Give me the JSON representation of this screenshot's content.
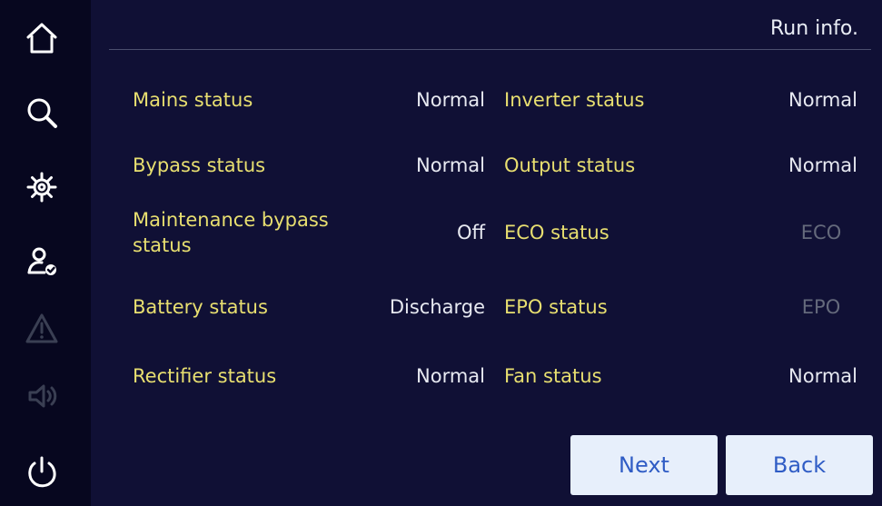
{
  "sidebar": {
    "icons": {
      "home": "home-icon",
      "search": "search-icon",
      "settings": "gear-icon",
      "user": "user-icon",
      "alarm": "warning-icon",
      "sound": "speaker-icon",
      "power": "power-icon"
    }
  },
  "header": {
    "title": "Run info."
  },
  "status": {
    "rows": [
      {
        "left_label": "Mains status",
        "left_value": "Normal",
        "right_label": "Inverter status",
        "right_value": "Normal"
      },
      {
        "left_label": "Bypass status",
        "left_value": "Normal",
        "right_label": "Output status",
        "right_value": "Normal"
      },
      {
        "left_label": "Maintenance bypass status",
        "left_value": "Off",
        "right_label": "ECO status",
        "right_value": "ECO"
      },
      {
        "left_label": "Battery status",
        "left_value": "Discharge",
        "right_label": "EPO status",
        "right_value": "EPO"
      },
      {
        "left_label": "Rectifier status",
        "left_value": "Normal",
        "right_label": "Fan status",
        "right_value": "Normal"
      }
    ]
  },
  "buttons": {
    "next": "Next",
    "back": "Back"
  },
  "colors": {
    "background": "#101035",
    "sidebar": "#07071f",
    "label": "#e8df70",
    "value": "#e7e9f1",
    "disabled_value": "#656a7c",
    "button_background": "#e7effb",
    "button_text": "#2f5cc5"
  }
}
